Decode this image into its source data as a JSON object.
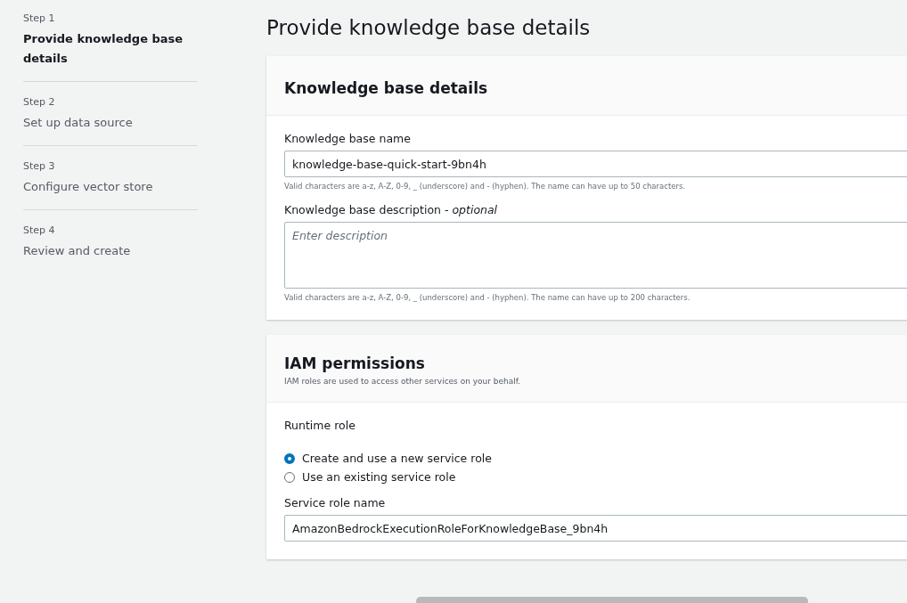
{
  "steps": [
    {
      "step": "Step 1",
      "title": "Provide knowledge base details",
      "selected": true
    },
    {
      "step": "Step 2",
      "title": "Set up data source",
      "selected": false
    },
    {
      "step": "Step 3",
      "title": "Configure vector store",
      "selected": false
    },
    {
      "step": "Step 4",
      "title": "Review and create",
      "selected": false
    }
  ],
  "page_title": "Provide knowledge base details",
  "details": {
    "heading": "Knowledge base details",
    "name_label": "Knowledge base name",
    "name_value": "knowledge-base-quick-start-9bn4h",
    "name_hint": "Valid characters are a-z, A-Z, 0-9, _ (underscore) and - (hyphen). The name can have up to 50 characters.",
    "description_label": "Knowledge base description - *optional*",
    "description_placeholder": "Enter description",
    "description_hint": "Valid characters are a-z, A-Z, 0-9, _ (underscore) and - (hyphen). The name can have up to 200 characters."
  },
  "iam": {
    "heading": "IAM permissions",
    "subheading": "IAM roles are used to access other services on your behalf.",
    "runtime_label": "Runtime role",
    "options": [
      {
        "label": "Create and use a new service role",
        "selected": true
      },
      {
        "label": "Use an existing service role",
        "selected": false
      }
    ],
    "role_name_label": "Service role name",
    "role_name_value": "AmazonBedrockExecutionRoleForKnowledgeBase_9bn4h"
  }
}
